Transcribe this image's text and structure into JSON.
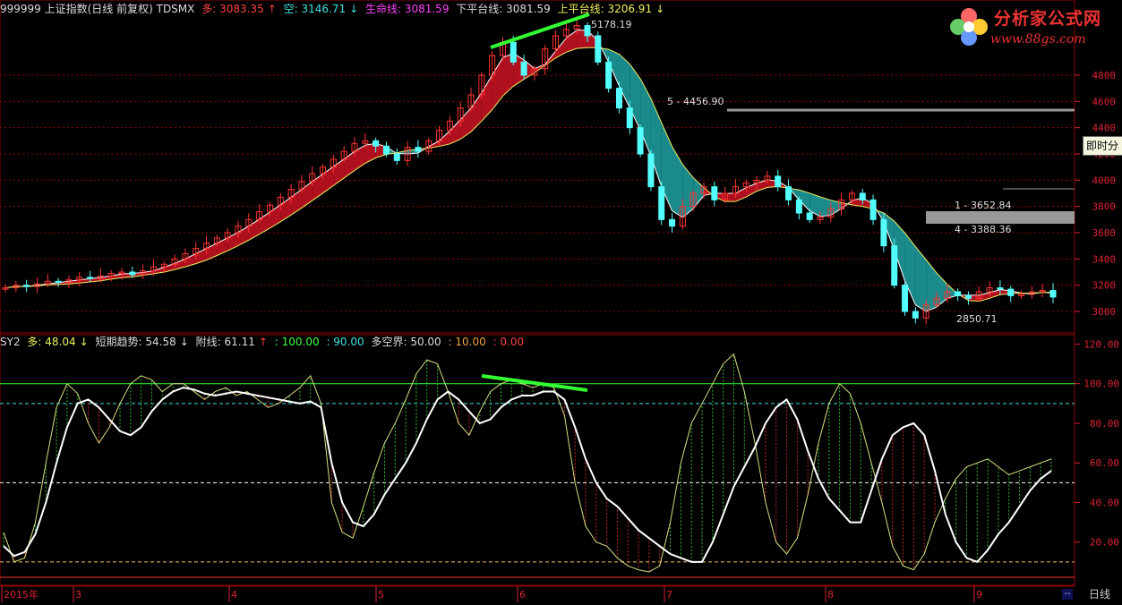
{
  "header": {
    "symbol": "999999 上证指数(日线 前复权) TDSMX",
    "duo_label": "多: 3083.35",
    "kong_label": "空: 3146.71",
    "life_label": "生命线: 3081.59",
    "lower_label": "下平台线: 3081.59",
    "upper_label": "上平台线: 3206.91"
  },
  "indicator_header": {
    "name": "SY2",
    "duo": "多: 48.04",
    "short_trend": "短期趋势: 54.58",
    "aux": "附线: 61.11",
    "l100": ": 100.00",
    "l90": ": 90.00",
    "boundary": "多空界: 50.00",
    "l10": ": 10.00",
    "l0": ": 0.00"
  },
  "logo": {
    "title": "分析家公式网",
    "url": "www.88gs.com"
  },
  "tooltip": "即时分",
  "bottom_tab": "日线",
  "bottom_dash": "--",
  "colors": {
    "up": "#ff3333",
    "down": "#54ffff",
    "band_up": "#b0101e",
    "band_down": "#1a8a8a",
    "grid": "#8b0000",
    "white": "#ffffff",
    "green": "#33ff33"
  },
  "chart_data": [
    {
      "type": "candlestick",
      "title": "999999 上证指数(日线 前复权) TDSMX",
      "x_months": [
        "2015年",
        "3",
        "4",
        "5",
        "6",
        "7",
        "8",
        "9"
      ],
      "y_ticks": [
        3000,
        3200,
        3400,
        3600,
        3800,
        4000,
        4200,
        4400,
        4600,
        4800
      ],
      "ylim": [
        2850,
        5250
      ],
      "annotations": [
        {
          "text": "5178.19",
          "value": 5178.19
        },
        {
          "text": "5 - 4456.90",
          "value": 4456.9
        },
        {
          "text": "1 - 3652.84",
          "value": 3652.84
        },
        {
          "text": "4 - 3388.36",
          "value": 3388.36
        },
        {
          "text": "2850.71",
          "value": 2850.71
        }
      ],
      "close_series": [
        3180,
        3200,
        3190,
        3210,
        3230,
        3220,
        3240,
        3260,
        3250,
        3270,
        3290,
        3300,
        3280,
        3310,
        3340,
        3360,
        3400,
        3440,
        3480,
        3520,
        3560,
        3600,
        3650,
        3700,
        3760,
        3810,
        3870,
        3930,
        3990,
        4050,
        4100,
        4160,
        4220,
        4280,
        4300,
        4260,
        4200,
        4150,
        4250,
        4220,
        4300,
        4380,
        4450,
        4550,
        4650,
        4800,
        4950,
        5050,
        4900,
        4800,
        4850,
        5000,
        5100,
        5150,
        5178,
        5100,
        4900,
        4700,
        4550,
        4400,
        4200,
        3950,
        3700,
        3650,
        3800,
        3900,
        3950,
        3850,
        3900,
        3950,
        3980,
        4000,
        4030,
        3950,
        3850,
        3750,
        3700,
        3720,
        3780,
        3850,
        3900,
        3850,
        3700,
        3500,
        3200,
        3000,
        2950,
        3050,
        3100,
        3150,
        3120,
        3100,
        3150,
        3180,
        3170,
        3120,
        3130,
        3150,
        3160,
        3110
      ]
    },
    {
      "type": "line",
      "title": "SY2",
      "y_ticks": [
        20,
        40,
        60,
        80,
        100,
        120
      ],
      "ylim": [
        0,
        122
      ],
      "reference_lines": [
        100,
        90,
        50,
        10
      ],
      "series": [
        {
          "name": "短期趋势",
          "values": [
            18,
            13,
            15,
            24,
            40,
            60,
            78,
            90,
            92,
            88,
            82,
            76,
            74,
            78,
            86,
            92,
            96,
            98,
            97,
            95,
            94,
            95,
            96,
            95,
            94,
            93,
            92,
            91,
            90,
            91,
            88,
            60,
            40,
            30,
            28,
            34,
            44,
            52,
            60,
            70,
            82,
            92,
            96,
            92,
            86,
            80,
            82,
            88,
            92,
            94,
            94,
            96,
            96,
            92,
            78,
            62,
            50,
            42,
            38,
            32,
            26,
            22,
            18,
            14,
            12,
            10,
            10,
            20,
            34,
            48,
            58,
            68,
            80,
            88,
            92,
            82,
            66,
            52,
            42,
            36,
            30,
            30,
            46,
            62,
            74,
            78,
            80,
            74,
            56,
            34,
            20,
            12,
            10,
            16,
            24,
            30,
            38,
            46,
            52,
            56
          ]
        },
        {
          "name": "多",
          "values": [
            25,
            10,
            12,
            30,
            60,
            88,
            100,
            95,
            80,
            70,
            78,
            90,
            100,
            104,
            102,
            96,
            100,
            100,
            96,
            92,
            96,
            98,
            94,
            96,
            92,
            88,
            90,
            94,
            98,
            104,
            90,
            40,
            25,
            22,
            38,
            55,
            70,
            80,
            92,
            105,
            112,
            110,
            96,
            80,
            74,
            86,
            96,
            100,
            102,
            100,
            98,
            100,
            98,
            84,
            50,
            28,
            20,
            18,
            12,
            8,
            6,
            5,
            8,
            30,
            60,
            80,
            90,
            100,
            110,
            115,
            96,
            70,
            40,
            20,
            14,
            22,
            44,
            70,
            90,
            100,
            95,
            80,
            60,
            40,
            18,
            8,
            6,
            14,
            30,
            42,
            52,
            58,
            60,
            62,
            58,
            54,
            56,
            58,
            60,
            62
          ]
        }
      ]
    }
  ]
}
